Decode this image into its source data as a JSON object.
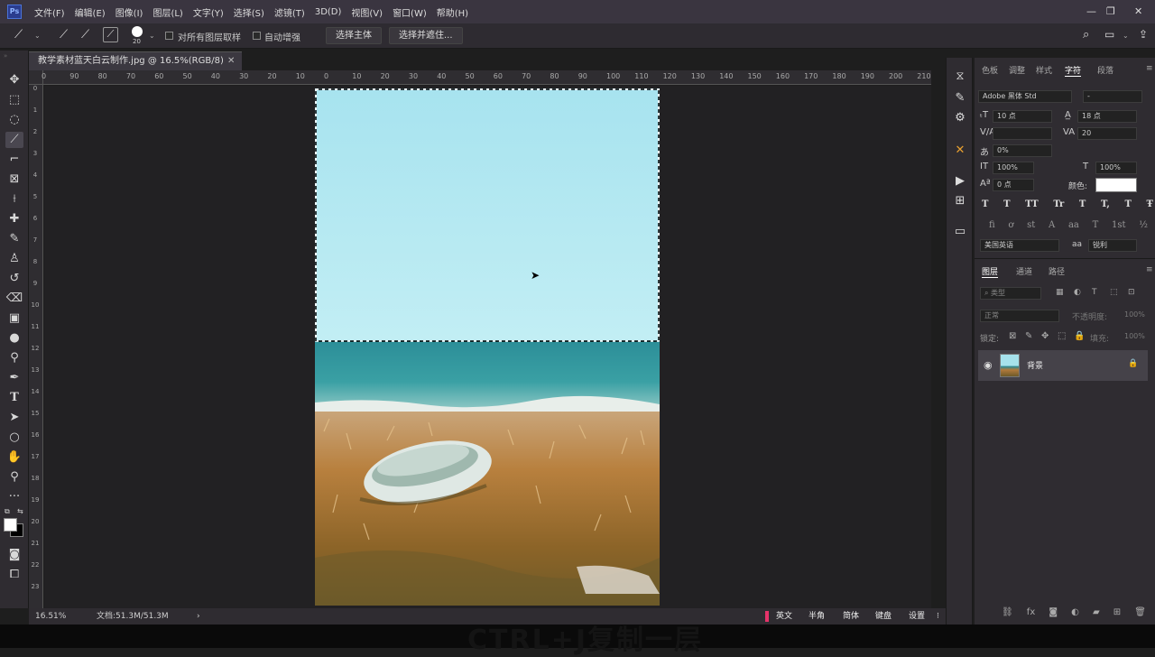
{
  "app": {
    "logo": "Ps",
    "menus": [
      "文件(F)",
      "编辑(E)",
      "图像(I)",
      "图层(L)",
      "文字(Y)",
      "选择(S)",
      "滤镜(T)",
      "3D(D)",
      "视图(V)",
      "窗口(W)",
      "帮助(H)"
    ]
  },
  "options": {
    "brush_size": "20",
    "sample_all_layers": "对所有图层取样",
    "auto_enhance": "自动增强",
    "select_subject": "选择主体",
    "select_and_mask": "选择并遮住..."
  },
  "document": {
    "tab_title": "教学素材蓝天白云制作.jpg @ 16.5%(RGB/8)"
  },
  "ruler": {
    "h_ticks": [
      "0",
      "90",
      "80",
      "70",
      "60",
      "50",
      "40",
      "30",
      "20",
      "10",
      "0",
      "10",
      "20",
      "30",
      "40",
      "50",
      "60",
      "70",
      "80",
      "90",
      "100",
      "110",
      "120",
      "130",
      "140",
      "150",
      "160",
      "170",
      "180",
      "190",
      "200",
      "210"
    ],
    "v_ticks": [
      "0",
      "1",
      "2",
      "3",
      "4",
      "5",
      "6",
      "7",
      "8",
      "9",
      "10",
      "11",
      "12",
      "13",
      "14",
      "15",
      "16",
      "17",
      "18",
      "19",
      "20",
      "21",
      "22",
      "23"
    ]
  },
  "status": {
    "zoom": "16.51%",
    "doc_size": "文档:51.3M/51.3M",
    "arrow": "›"
  },
  "ime": {
    "items": [
      "英文",
      "半角",
      "简体",
      "键盘",
      "设置"
    ]
  },
  "character_panel": {
    "tabs": [
      "色板",
      "调整",
      "样式",
      "字符",
      "段落"
    ],
    "font_family": "Adobe 黑体 Std",
    "font_style": "-",
    "font_size": "10 点",
    "leading": "18 点",
    "tracking": "20",
    "kerning": "",
    "vert_scale_pct": "0%",
    "vscale": "100%",
    "hscale": "100%",
    "baseline": "0 点",
    "color_label": "颜色:",
    "language": "美国英语",
    "aa_label": "aa",
    "antialias": "锐利",
    "style_buttons": [
      "T",
      "T",
      "TT",
      "Tr",
      "T",
      "T,",
      "T",
      "Ŧ"
    ],
    "opentype_buttons": [
      "fi",
      "ơ",
      "st",
      "A",
      "aa",
      "T",
      "1st",
      "½"
    ]
  },
  "layers_panel": {
    "tabs": [
      "图层",
      "通道",
      "路径"
    ],
    "filter_label": "类型",
    "blend_mode": "正常",
    "opacity_label": "不透明度:",
    "opacity_value": "100%",
    "lock_label": "锁定:",
    "fill_label": "填充:",
    "fill_value": "100%",
    "layer_name": "背景"
  },
  "subtitle": "CTRL+J复制一层",
  "colors": {
    "menubar": "#3a3540",
    "panel": "#2f2c31",
    "sky": "#a6e2ec",
    "sea": "#2e8a93",
    "grass": "#b07a3c"
  }
}
